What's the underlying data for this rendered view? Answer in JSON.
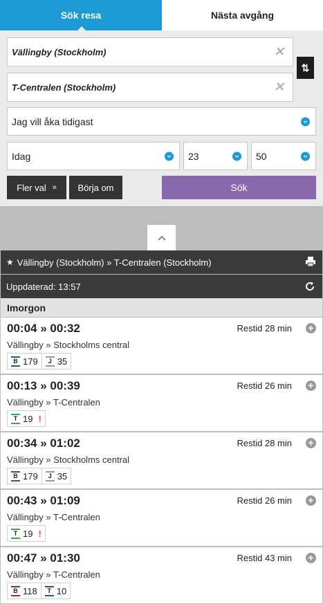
{
  "tabs": {
    "search": "Sök resa",
    "next": "Nästa avgång"
  },
  "form": {
    "from": "Vällingby (Stockholm)",
    "to": "T-Centralen (Stockholm)",
    "when_type": "Jag vill åka tidigast",
    "day": "Idag",
    "hour": "23",
    "minute": "50",
    "more_label": "Fler val",
    "reset_label": "Börja om",
    "search_label": "Sök"
  },
  "results": {
    "route_title": "Vällingby (Stockholm) » T-Centralen (Stockholm)",
    "updated": "Uppdaterad: 13:57",
    "day_heading": "Imorgon",
    "trips": [
      {
        "times": "00:04 » 00:32",
        "duration": "Restid 28 min",
        "via": "Vällingby » Stockholms central",
        "legs": [
          {
            "mode": "B",
            "line": "179",
            "color": "#1d5a8f"
          },
          {
            "mode": "J",
            "line": "35",
            "color": "#9a9a9a"
          }
        ],
        "warning": ""
      },
      {
        "times": "00:13 » 00:39",
        "duration": "Restid 26 min",
        "via": "Vällingby » T-Centralen",
        "legs": [
          {
            "mode": "T",
            "line": "19",
            "color": "#3fa34d"
          }
        ],
        "warning": "!"
      },
      {
        "times": "00:34 » 01:02",
        "duration": "Restid 28 min",
        "via": "Vällingby » Stockholms central",
        "legs": [
          {
            "mode": "B",
            "line": "179",
            "color": "#1d5a8f"
          },
          {
            "mode": "J",
            "line": "35",
            "color": "#9a9a9a"
          }
        ],
        "warning": ""
      },
      {
        "times": "00:43 » 01:09",
        "duration": "Restid 26 min",
        "via": "Vällingby » T-Centralen",
        "legs": [
          {
            "mode": "T",
            "line": "19",
            "color": "#3fa34d"
          }
        ],
        "warning": "!"
      },
      {
        "times": "00:47 » 01:30",
        "duration": "Restid 43 min",
        "via": "Vällingby » T-Centralen",
        "legs": [
          {
            "mode": "B",
            "line": "118",
            "color": "#a3243b"
          },
          {
            "mode": "T",
            "line": "10",
            "color": "#1d5a8f"
          }
        ],
        "warning": ""
      }
    ]
  },
  "colors": {
    "accent": "#1b9ad6",
    "search_button": "#8a67ae",
    "dark_bar": "#3a3a3a",
    "warning": "#e8542b"
  },
  "icons": {
    "clear": "close-icon",
    "swap": "swap-icon",
    "dropdown": "chevron-down-icon",
    "collapse": "chevron-up-icon",
    "favorite": "star-icon",
    "print": "print-icon",
    "refresh": "refresh-icon",
    "expand": "plus-icon"
  }
}
